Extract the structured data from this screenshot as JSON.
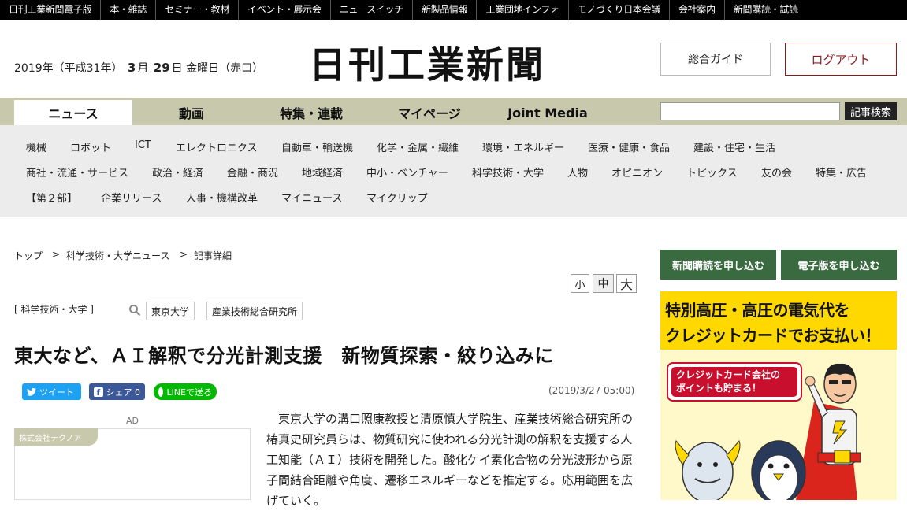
{
  "topbar": {
    "items": [
      "日刊工業新聞電子版",
      "本・雑誌",
      "セミナー・教材",
      "イベント・展示会",
      "ニュースイッチ",
      "新製品情報",
      "工業団地インフォ",
      "モノづくり日本会議",
      "会社案内",
      "新聞購読・試読"
    ]
  },
  "header": {
    "date_prefix": "2019年（平成31年）",
    "month": "3",
    "month_unit": "月",
    "day": "29",
    "day_unit": "日",
    "weekday": "金曜日（赤口）",
    "logo": "日刊工業新聞",
    "guide_label": "総合ガイド",
    "logout_label": "ログアウト"
  },
  "mainnav": {
    "tabs": [
      "ニュース",
      "動画",
      "特集・連載",
      "マイページ",
      "Joint Media"
    ],
    "search_button": "記事検索"
  },
  "categories": {
    "row1": [
      "機械",
      "ロボット",
      "ICT",
      "エレクトロニクス",
      "自動車・輸送機",
      "化学・金属・繊維",
      "環境・エネルギー",
      "医療・健康・食品",
      "建設・住宅・生活"
    ],
    "row2": [
      "商社・流通・サービス",
      "政治・経済",
      "金融・商況",
      "地域経済",
      "中小・ベンチャー",
      "科学技術・大学",
      "人物",
      "オピニオン",
      "トピックス",
      "友の会",
      "特集・広告"
    ],
    "row3": [
      "【第２部】",
      "企業リリース",
      "人事・機構改革",
      "マイニュース",
      "マイクリップ"
    ]
  },
  "breadcrumb": {
    "items": [
      "トップ",
      "科学技術・大学ニュース",
      "記事詳細"
    ],
    "separator": ">"
  },
  "font_size": {
    "small": "小",
    "medium": "中",
    "large": "大"
  },
  "article": {
    "section": "[ 科学技術・大学 ]",
    "tags": [
      "東京大学",
      "産業技術総合研究所"
    ],
    "headline": "東大など、ＡＩ解釈で分光計測支援　新物質探索・絞り込みに",
    "date": "(2019/3/27 05:00)",
    "body": "東京大学の溝口照康教授と清原慎大学院生、産業技術総合研究所の椿真史研究員らは、物質研究に使われる分光計測の解釈を支援する人工知能（ＡＩ）技術を開発した。酸化ケイ素化合物の分光波形から原子間結合距離や角度、遷移エネルギーなどを推定する。応用範囲を広げていく。"
  },
  "share": {
    "tweet": "ツイート",
    "facebook": "シェア 0",
    "line": "LINEで送る"
  },
  "ad": {
    "label": "AD",
    "company": "株式会社テクノア"
  },
  "sidebar": {
    "subscribe_newspaper": "新聞購読を申し込む",
    "subscribe_digital": "電子版を申し込む",
    "banner_line1": "特別高圧・高圧の電気代を",
    "banner_line2": "クレジットカードでお支払い！",
    "bubble_line1": "クレジットカード会社の",
    "bubble_line2": "ポイントも貯まる！"
  },
  "colors": {
    "nav_bg": "#c8c8ad",
    "accent_green": "#3a6b40",
    "logout_red": "#8a1c1c",
    "banner_yellow": "#ffd800"
  }
}
